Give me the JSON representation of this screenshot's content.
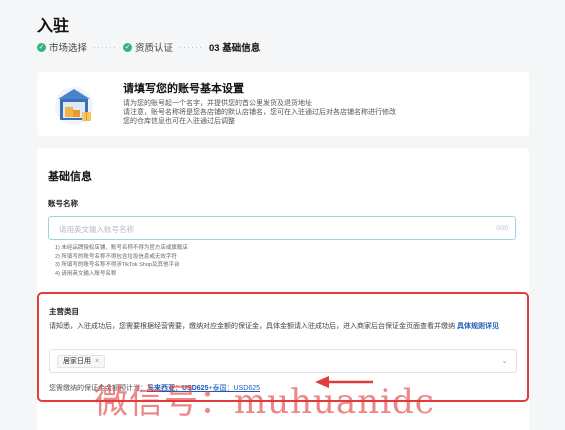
{
  "header": {
    "title": "入驻",
    "steps": [
      {
        "label": "市场选择",
        "done": true
      },
      {
        "label": "资质认证",
        "done": true
      },
      {
        "label": "03 基础信息",
        "done": false
      }
    ],
    "step_separator": "······"
  },
  "intro": {
    "title": "请填写您的账号基本设置",
    "lines": [
      "请为您的账号起一个名字，并提供您的首公里发货及退货地址",
      "请注意，账号名称将是您各店铺的默认店铺名，您可在入驻通过后对各店铺名称进行修改",
      "您的仓库信息也可在入驻通过后调整"
    ],
    "illustration_icon": "warehouse-box-illustration"
  },
  "basic_info": {
    "section_title": "基础信息",
    "account_name_label": "账号名称",
    "account_name_placeholder": "请用英文输入账号名称",
    "account_name_counter": "0/20",
    "rules": [
      "1) 未经品牌授权店铺，账号名称不得为官方店或旗舰店",
      "2) 所填写的账号名称不得包含垃圾信息或无效字符",
      "3) 所填写的账号名称不得涉TikTok Shop及其他平台",
      "4) 请用英文输入账号名称"
    ]
  },
  "category": {
    "label": "主营类目",
    "description_prefix": "请知悉，入驻成功后，您需要根据经营需要，缴纳对应金额的保证金，具体金额请入驻成功后，进入商家后台保证金页面查看并缴纳 ",
    "rules_link": "具体规则详见",
    "selected_tag": "居家日用",
    "tag_close": "×",
    "chevron": "⌄",
    "deposit_prefix": "您需缴纳的保证金金额预计为：",
    "deposit_region1": "马来西亚：USD625",
    "deposit_plus": "+",
    "deposit_region2": "泰国：USD625"
  },
  "watermark": "微信号：muhuanidc",
  "colors": {
    "accent_green": "#2fb67c",
    "highlight_red": "#e23b3b",
    "link_blue": "#1e5bb8"
  }
}
